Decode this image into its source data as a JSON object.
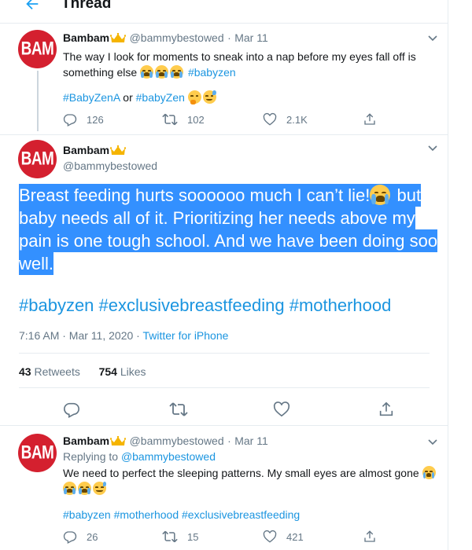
{
  "header": {
    "title": "Thread",
    "back_icon": "arrow-left-icon"
  },
  "colors": {
    "accent": "#1da1f2",
    "link": "#1b95e0",
    "avatar_bg": "#d4202f",
    "selection": "#3390ff"
  },
  "tweets": [
    {
      "avatar_text": "BAM",
      "name": "Bambam",
      "handle": "@bammybestowed",
      "sep": "·",
      "date": "Mar 11",
      "line1": "The way I look for moments to sneak into a nap before my eyes fall off is",
      "line2_text": "something else",
      "line2_tag": "#babyzen",
      "tag_a": "#BabyZenA",
      "or_text": "or",
      "tag_b": "#babyZen",
      "replies": "126",
      "retweets": "102",
      "likes": "2.1K"
    },
    {
      "avatar_text": "BAM",
      "name": "Bambam",
      "handle": "@bammybestowed",
      "body_1": "Breast feeding hurts soooooo much I can’t lie!",
      "body_2": " but baby needs all of it. Prioritizing her needs above my pain is one tough school. And we have been doing soo well.",
      "hashtags": [
        "#babyzen",
        "#exclusivebreastfeeding",
        "#motherhood"
      ],
      "time": "7:16 AM · Mar 11, 2020",
      "sep": "·",
      "via": "Twitter for iPhone",
      "retweets_count": "43",
      "retweets_label": "Retweets",
      "likes_count": "754",
      "likes_label": "Likes"
    },
    {
      "avatar_text": "BAM",
      "name": "Bambam",
      "handle": "@bammybestowed",
      "sep": "·",
      "date": "Mar 11",
      "replying_label": "Replying to",
      "replying_to": "@bammybestowed",
      "line1": "We need to perfect the sleeping patterns. My small eyes are almost gone",
      "hashtags": [
        "#babyzen",
        "#motherhood",
        "#exclusivebreastfeeding"
      ],
      "replies": "26",
      "retweets": "15",
      "likes": "421"
    }
  ]
}
